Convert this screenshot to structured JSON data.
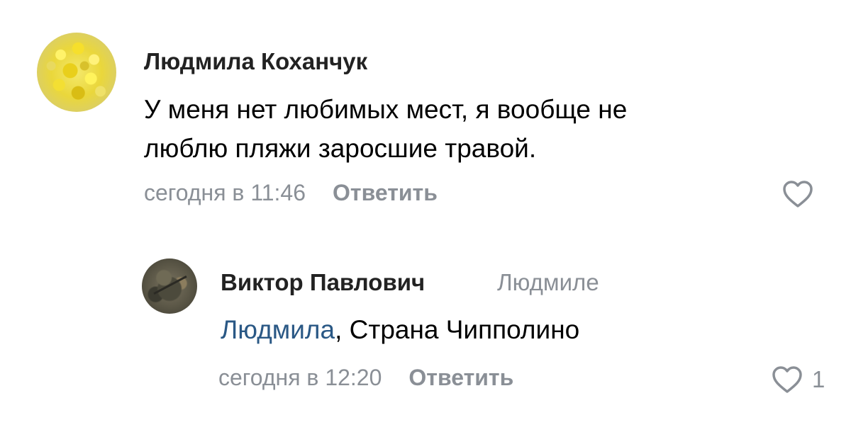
{
  "colors": {
    "primary_text": "#000000",
    "author_text": "#222222",
    "secondary_text": "#8a8f96",
    "mention": "#2a5885",
    "background": "#ffffff"
  },
  "comments": [
    {
      "avatar": "mimosa-avatar",
      "author": "Людмила Коханчук",
      "lines": [
        "У меня нет любимых мест, я вообще не",
        "люблю пляжи заросшие травой."
      ],
      "time": "сегодня в 11:46",
      "reply_label": "Ответить",
      "like_icon": "heart-outline-icon",
      "like_count": ""
    },
    {
      "avatar": "soldier-avatar",
      "author": "Виктор Павлович",
      "reply_to": "Людмиле",
      "mention": "Людмила",
      "text_after_mention": ", Страна Чипполино",
      "time": "сегодня в 12:20",
      "reply_label": "Ответить",
      "like_icon": "heart-outline-icon",
      "like_count": "1"
    }
  ]
}
